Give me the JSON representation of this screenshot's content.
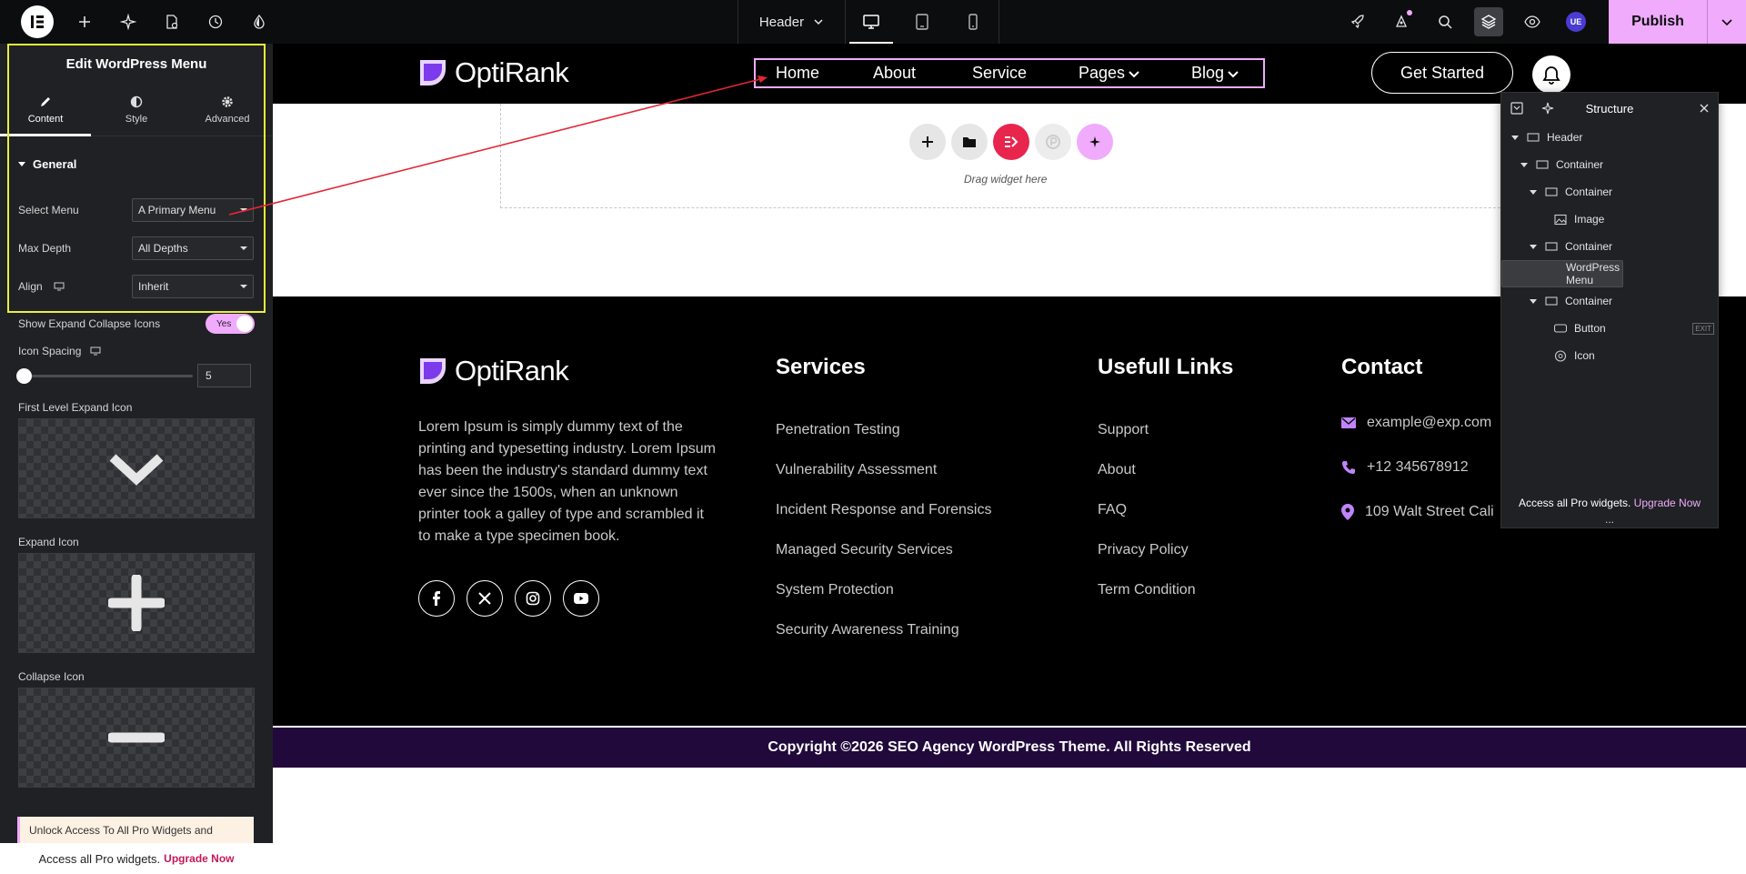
{
  "topbar": {
    "document_name": "Header",
    "publish_label": "Publish",
    "user_initials": "UE",
    "colors": {
      "accent": "#f0abfc",
      "bar": "#0c0d0e"
    }
  },
  "panel": {
    "title": "Edit WordPress Menu",
    "tabs": [
      {
        "label": "Content",
        "icon": "pencil-icon"
      },
      {
        "label": "Style",
        "icon": "half-circle-icon"
      },
      {
        "label": "Advanced",
        "icon": "gear-icon"
      }
    ],
    "section": "General",
    "controls": {
      "select_menu": {
        "label": "Select Menu",
        "value": "A Primary Menu"
      },
      "max_depth": {
        "label": "Max Depth",
        "value": "All Depths"
      },
      "align": {
        "label": "Align",
        "value": "Inherit"
      },
      "show_expand": {
        "label": "Show Expand Collapse Icons",
        "value": "Yes"
      },
      "icon_spacing": {
        "label": "Icon Spacing",
        "value": "5"
      },
      "first_level_icon": {
        "label": "First Level Expand Icon",
        "icon": "chevron-down-icon"
      },
      "expand_icon": {
        "label": "Expand Icon",
        "icon": "plus-icon"
      },
      "collapse_icon": {
        "label": "Collapse Icon",
        "icon": "minus-icon"
      }
    },
    "promo": "Unlock Access To All Pro Widgets and",
    "footer_text": "Access all Pro widgets.",
    "footer_link": "Upgrade Now"
  },
  "site": {
    "brand": "OptiRank",
    "menu": [
      "Home",
      "About",
      "Service",
      "Pages",
      "Blog"
    ],
    "cta": "Get Started",
    "drop_text": "Drag widget here",
    "footer": {
      "about": "Lorem Ipsum is simply dummy text of the printing and typesetting industry. Lorem Ipsum has been the industry's standard dummy text ever since the 1500s, when an unknown printer took a galley of type and scrambled it to make a type specimen book.",
      "services_title": "Services",
      "services": [
        "Penetration Testing",
        "Vulnerability Assessment",
        "Incident Response and Forensics",
        "Managed Security Services",
        "System Protection",
        "Security Awareness Training"
      ],
      "links_title": "Usefull Links",
      "links": [
        "Support",
        "About",
        "FAQ",
        "Privacy Policy",
        "Term Condition"
      ],
      "contact_title": "Contact",
      "email": "example@exp.com",
      "phone": "+12 345678912",
      "address": "109 Walt Street Cali",
      "copyright": "Copyright ©2026 SEO Agency WordPress Theme. All Rights Reserved"
    }
  },
  "structure": {
    "title": "Structure",
    "items": [
      {
        "label": "Header",
        "depth": 0,
        "caret": true,
        "icon": "container-icon"
      },
      {
        "label": "Container",
        "depth": 1,
        "caret": true,
        "icon": "container-icon"
      },
      {
        "label": "Container",
        "depth": 2,
        "caret": true,
        "icon": "container-icon"
      },
      {
        "label": "Image",
        "depth": 3,
        "caret": false,
        "icon": "image-icon"
      },
      {
        "label": "Container",
        "depth": 2,
        "caret": true,
        "icon": "container-icon"
      },
      {
        "label": "WordPress Menu",
        "depth": 3,
        "caret": false,
        "icon": "",
        "selected": true
      },
      {
        "label": "Container",
        "depth": 2,
        "caret": true,
        "icon": "container-icon"
      },
      {
        "label": "Button",
        "depth": 3,
        "caret": false,
        "icon": "button-icon",
        "badge": "EXIT"
      },
      {
        "label": "Icon",
        "depth": 3,
        "caret": false,
        "icon": "icon-widget-icon"
      }
    ],
    "footer_text": "Access all Pro widgets.",
    "footer_link": "Upgrade Now",
    "more": "..."
  }
}
